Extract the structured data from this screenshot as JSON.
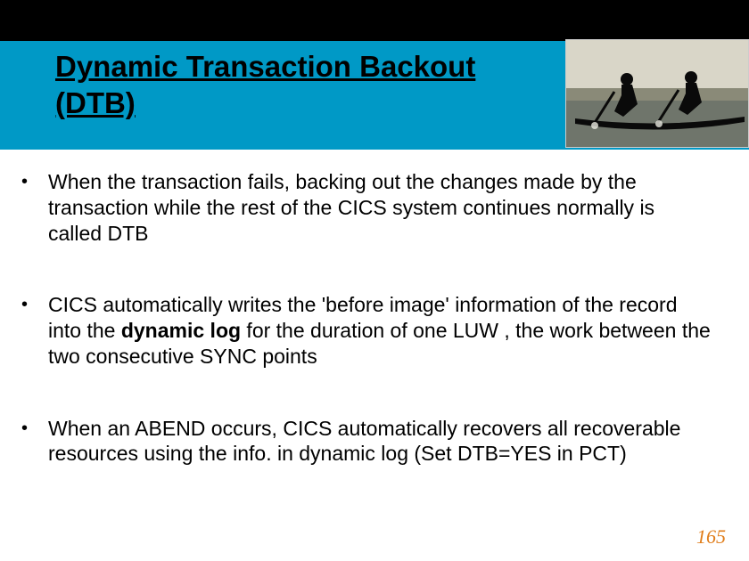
{
  "title": "Dynamic Transaction Backout (DTB)",
  "bullets": [
    {
      "pre": " When the transaction fails, backing out the changes made by the transaction while the rest of the CICS system continues normally is called DTB",
      "bold": "",
      "post": ""
    },
    {
      "pre": "CICS automatically writes the 'before image' information of the record into the ",
      "bold": "dynamic log",
      "post": " for the duration of one LUW , the work between the two consecutive SYNC points"
    },
    {
      "pre": "When an ABEND occurs, CICS automatically recovers all recoverable resources using the info. in  dynamic log (Set DTB=YES in PCT)",
      "bold": "",
      "post": ""
    }
  ],
  "page_number": "165"
}
